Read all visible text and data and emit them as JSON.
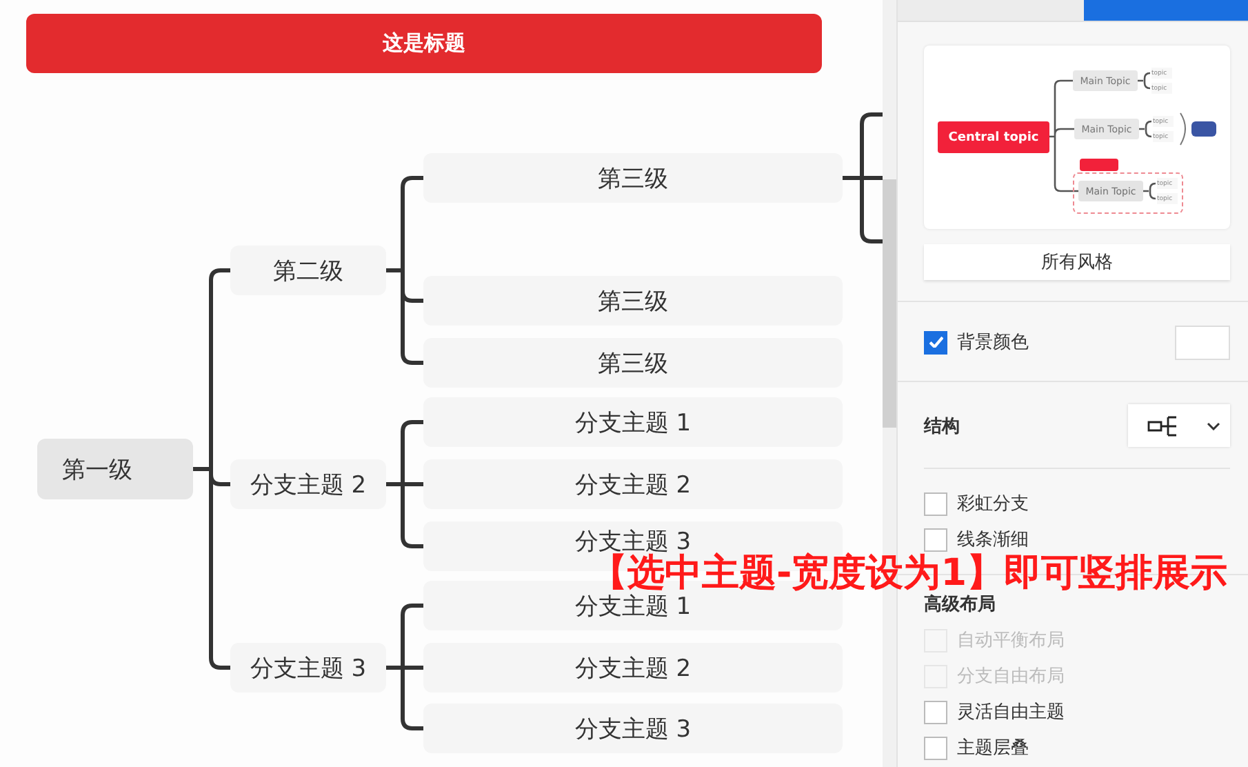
{
  "title_bar": {
    "text": "这是标题"
  },
  "mind_map": {
    "root": {
      "text": "第一级",
      "children": [
        {
          "text": "第二级",
          "children": [
            {
              "text": "第三级",
              "overflow_branch": true
            },
            {
              "text": "第三级",
              "overflow_branch": false
            },
            {
              "text": "第三级",
              "overflow_branch": false
            }
          ]
        },
        {
          "text": "分支主题 2",
          "children": [
            {
              "text": "分支主题 1",
              "overflow_branch": false
            },
            {
              "text": "分支主题 2",
              "overflow_branch": false
            },
            {
              "text": "分支主题 3",
              "overflow_branch": false
            }
          ]
        },
        {
          "text": "分支主题 3",
          "children": [
            {
              "text": "分支主题 1",
              "overflow_branch": false
            },
            {
              "text": "分支主题 2",
              "overflow_branch": false
            },
            {
              "text": "分支主题 3",
              "overflow_branch": false
            }
          ]
        }
      ]
    }
  },
  "sidebar": {
    "tabs": [
      {
        "selected": false
      },
      {
        "selected": true
      }
    ],
    "style_preview": {
      "central": "Central topic",
      "main_topics": [
        {
          "text": "Main Topic",
          "topics": [
            "topic",
            "topic"
          ],
          "selected": false
        },
        {
          "text": "Main Topic",
          "topics": [
            "topic",
            "topic"
          ],
          "selected": false
        },
        {
          "text": "Main Topic",
          "topics": [
            "topic",
            "topic"
          ],
          "selected": true
        }
      ]
    },
    "all_styles_button": "所有风格",
    "background_color": {
      "label": "背景颜色",
      "checked": true
    },
    "structure": {
      "label": "结构"
    },
    "options": [
      {
        "label": "彩虹分支",
        "checked": false,
        "disabled": false
      },
      {
        "label": "线条渐细",
        "checked": false,
        "disabled": false
      }
    ],
    "advanced_layout": {
      "title": "高级布局",
      "options": [
        {
          "label": "自动平衡布局",
          "checked": false,
          "disabled": true
        },
        {
          "label": "分支自由布局",
          "checked": false,
          "disabled": true
        },
        {
          "label": "灵活自由主题",
          "checked": false,
          "disabled": false
        },
        {
          "label": "主题层叠",
          "checked": false,
          "disabled": false
        }
      ]
    }
  },
  "annotation": "【选中主题-宽度设为1】即可竖排展示"
}
